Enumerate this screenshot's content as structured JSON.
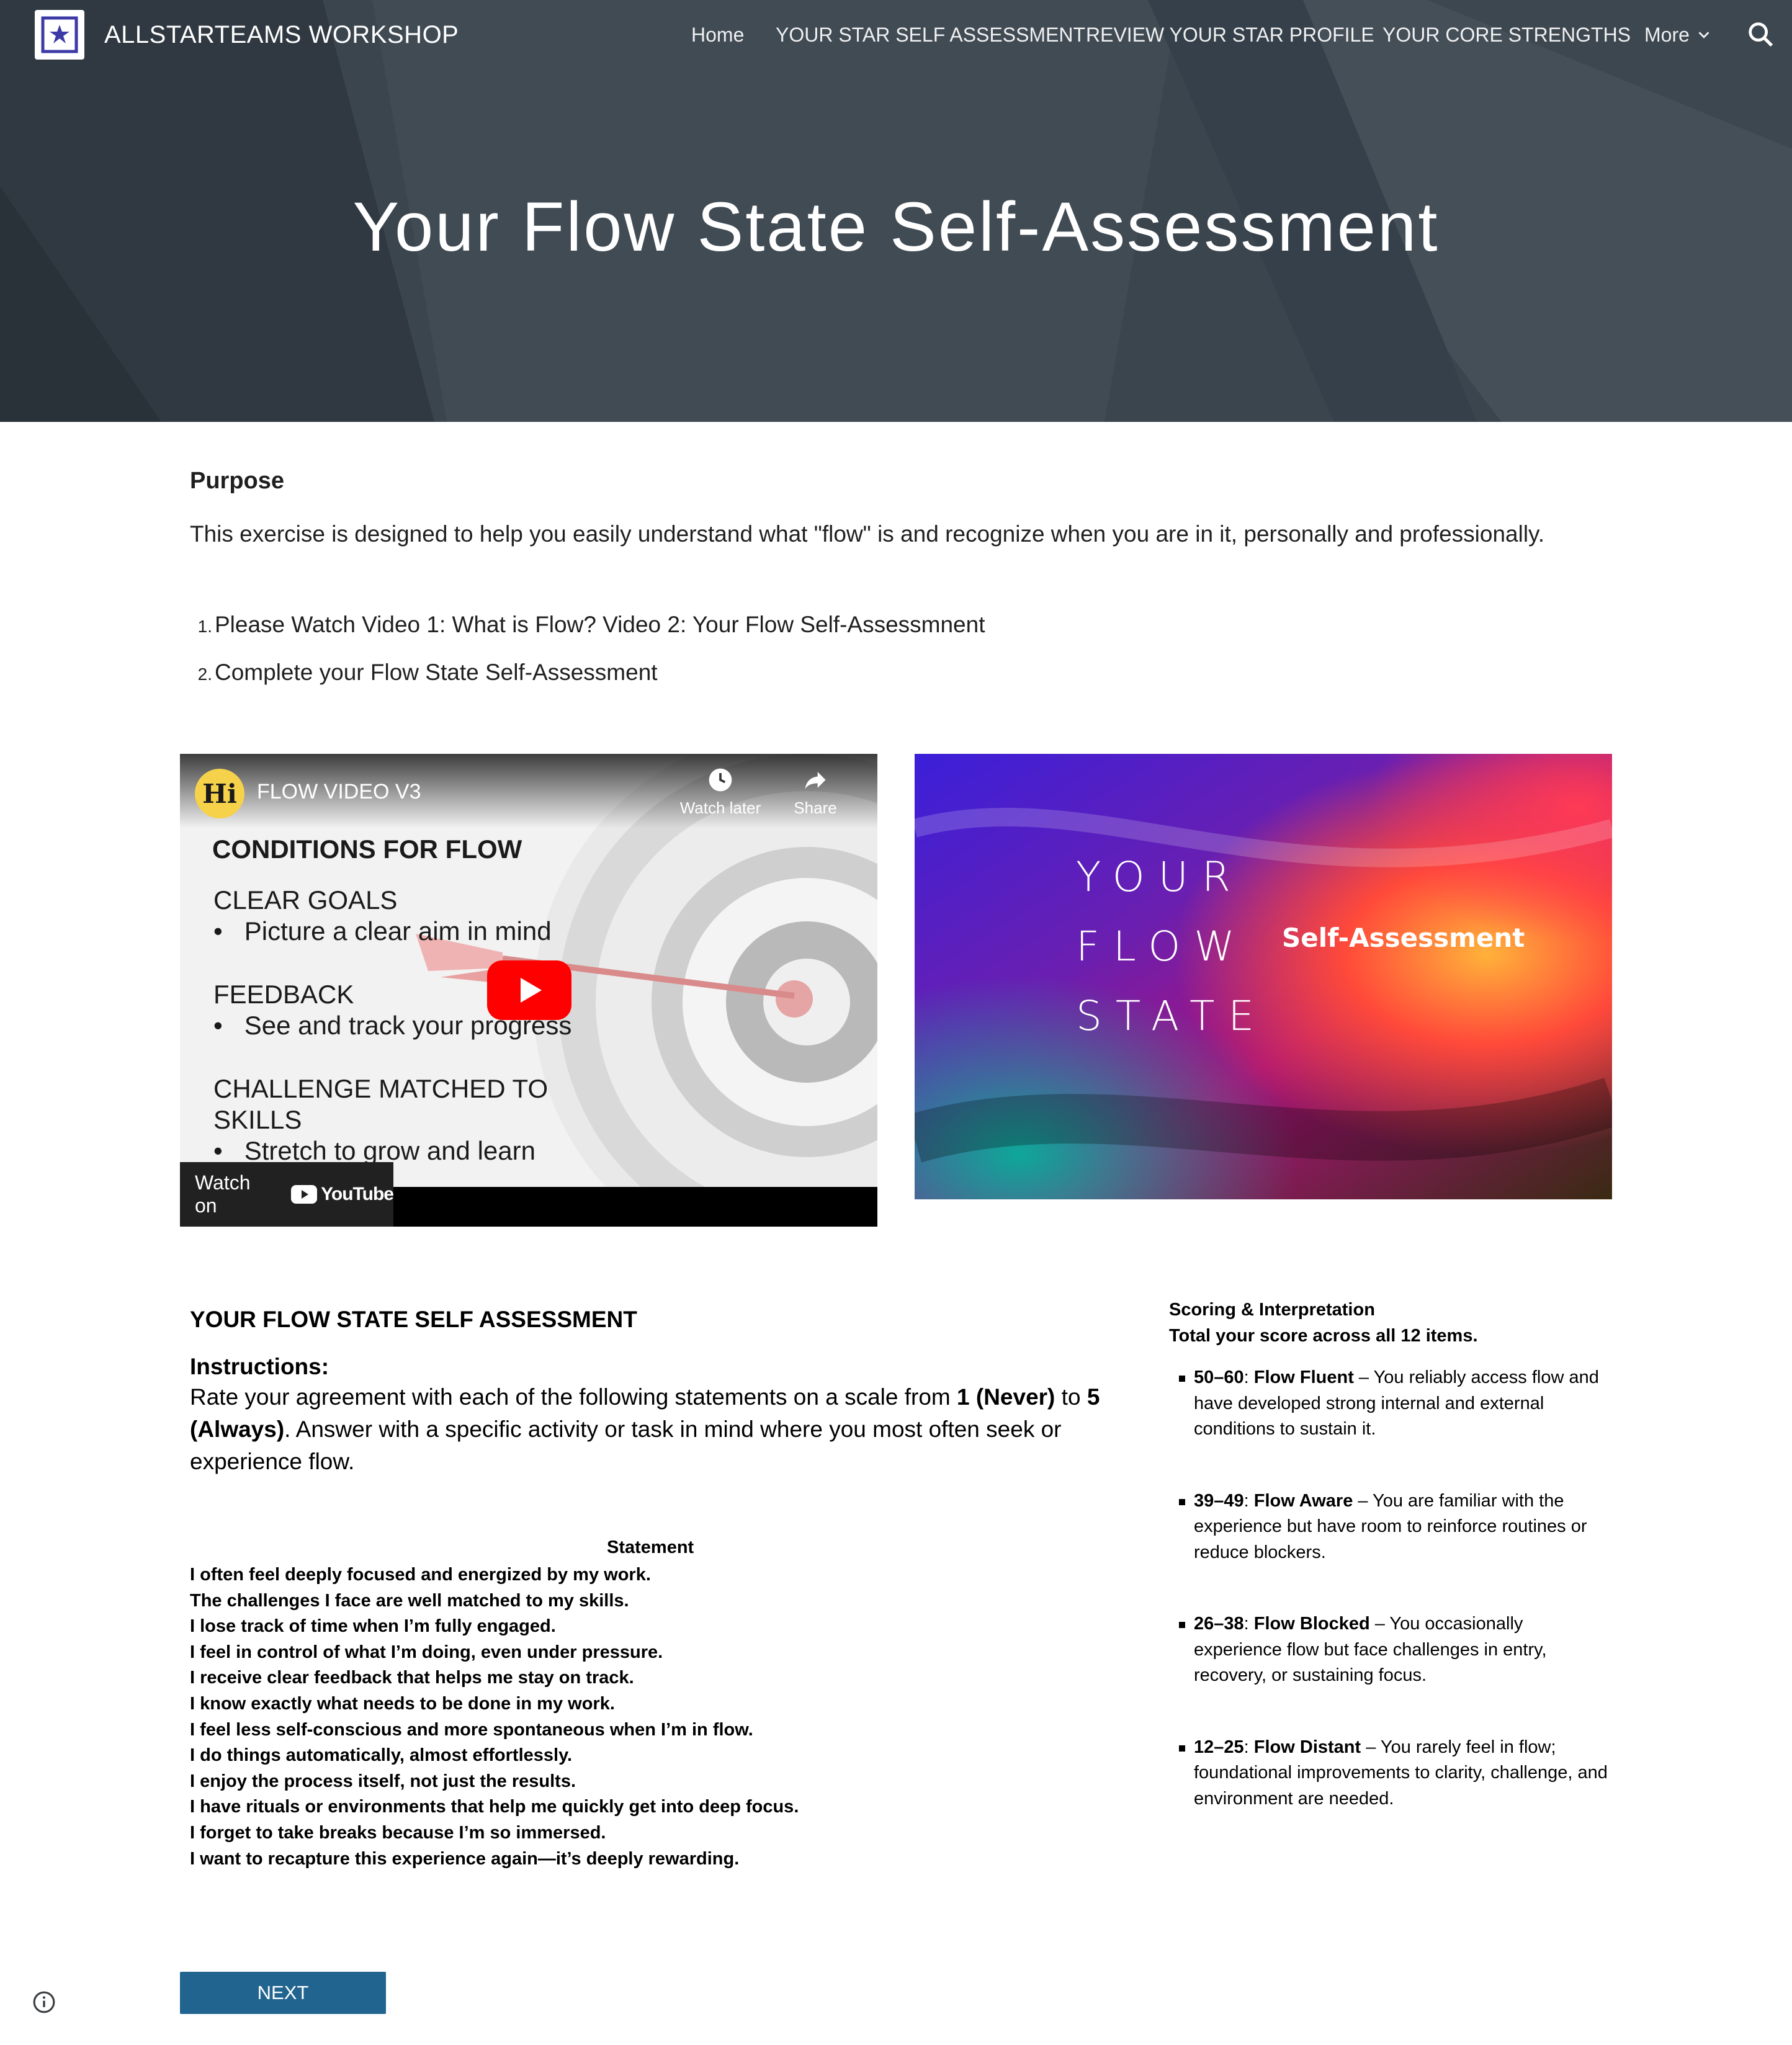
{
  "header": {
    "site_title": "ALLSTARTEAMS WORKSHOP",
    "nav": [
      {
        "label": "Home"
      },
      {
        "label": "YOUR STAR SELF ASSESSMENT"
      },
      {
        "label": "REVIEW YOUR STAR PROFILE"
      },
      {
        "label": "YOUR CORE STRENGTHS"
      },
      {
        "label": "More"
      }
    ],
    "icons": {
      "logo": "star-logo-icon",
      "more": "chevron-down-icon",
      "search": "search-icon"
    },
    "colors": {
      "banner": "#3a444d",
      "text": "#ffffff"
    }
  },
  "hero": {
    "title": "Your Flow State Self-Assessment"
  },
  "purpose": {
    "heading": "Purpose",
    "text": "This exercise is designed to help you easily understand what \"flow\" is and recognize when you are in it, personally and professionally.",
    "steps": [
      {
        "num": "1.",
        "text": "Please Watch Video 1: What is Flow? Video 2: Your Flow Self-Assessmnent"
      },
      {
        "num": "2.",
        "text": "Complete your Flow State Self-Assessment"
      }
    ]
  },
  "video": {
    "channel_initials": "Hi",
    "title": "FLOW VIDEO V3",
    "watch_later": "Watch later",
    "share": "Share",
    "slide_heading": "CONDITIONS FOR FLOW",
    "slide_items": [
      {
        "label": "CLEAR GOALS",
        "bullet": "Picture a clear aim in mind"
      },
      {
        "label": "FEEDBACK",
        "bullet": "See and track your progress"
      },
      {
        "label_line1": "CHALLENGE MATCHED TO",
        "label_line2": "SKILLS",
        "bullet": "Stretch to grow and learn"
      }
    ],
    "watch_on": "Watch on",
    "youtube": "YouTube",
    "icons": {
      "play": "play-icon",
      "clock": "clock-icon",
      "share": "share-icon"
    },
    "colors": {
      "play": "#ff0000"
    }
  },
  "flow_image": {
    "words": [
      "YOUR",
      "FLOW",
      "STATE"
    ],
    "subtitle": "Self-Assessment"
  },
  "assessment": {
    "title": "YOUR FLOW STATE SELF ASSESSMENT",
    "instructions_heading": "Instructions:",
    "instr_before": "Rate your agreement with each of the following statements on a scale from ",
    "scale_low": "1 (Never)",
    "instr_mid": " to ",
    "scale_high": "5 (Always)",
    "instr_after": ". Answer with a specific activity or task in mind where you most often seek or experience flow.",
    "statement_header": "Statement",
    "statements": [
      "I often feel deeply focused and energized by my work.",
      "The challenges I face are well matched to my skills.",
      "I lose track of time when I’m fully engaged.",
      "I feel in control of what I’m doing, even under pressure.",
      "I receive clear feedback that helps me stay on track.",
      "I know exactly what needs to be done in my work.",
      "I feel less self-conscious and more spontaneous when I’m in flow.",
      "I do things automatically, almost effortlessly.",
      "I enjoy the process itself, not just the results.",
      "I have rituals or environments that help me quickly get into deep focus.",
      "I forget to take breaks because I’m so immersed.",
      "I want to recapture this experience again—it’s deeply rewarding."
    ]
  },
  "scoring": {
    "heading": "Scoring & Interpretation",
    "subheading": "Total your score across all 12 items.",
    "items": [
      {
        "range": "50–60",
        "sep": ": ",
        "name": "Flow Fluent",
        "desc": " – You reliably access flow and have developed strong internal and external conditions to sustain it."
      },
      {
        "range": "39–49",
        "sep": ": ",
        "name": "Flow Aware",
        "desc": " – You are familiar with the experience but have room to reinforce routines or reduce blockers."
      },
      {
        "range": "26–38",
        "sep": ": ",
        "name": "Flow Blocked",
        "desc": " – You occasionally experience flow but face challenges in entry, recovery, or sustaining focus."
      },
      {
        "range": "12–25",
        "sep": ": ",
        "name": "Flow Distant",
        "desc": " – You rarely feel in flow; foundational improvements to clarity, challenge, and environment are needed."
      }
    ]
  },
  "footer": {
    "next_label": "NEXT",
    "icons": {
      "info": "info-icon"
    },
    "colors": {
      "next": "#21648f"
    }
  }
}
